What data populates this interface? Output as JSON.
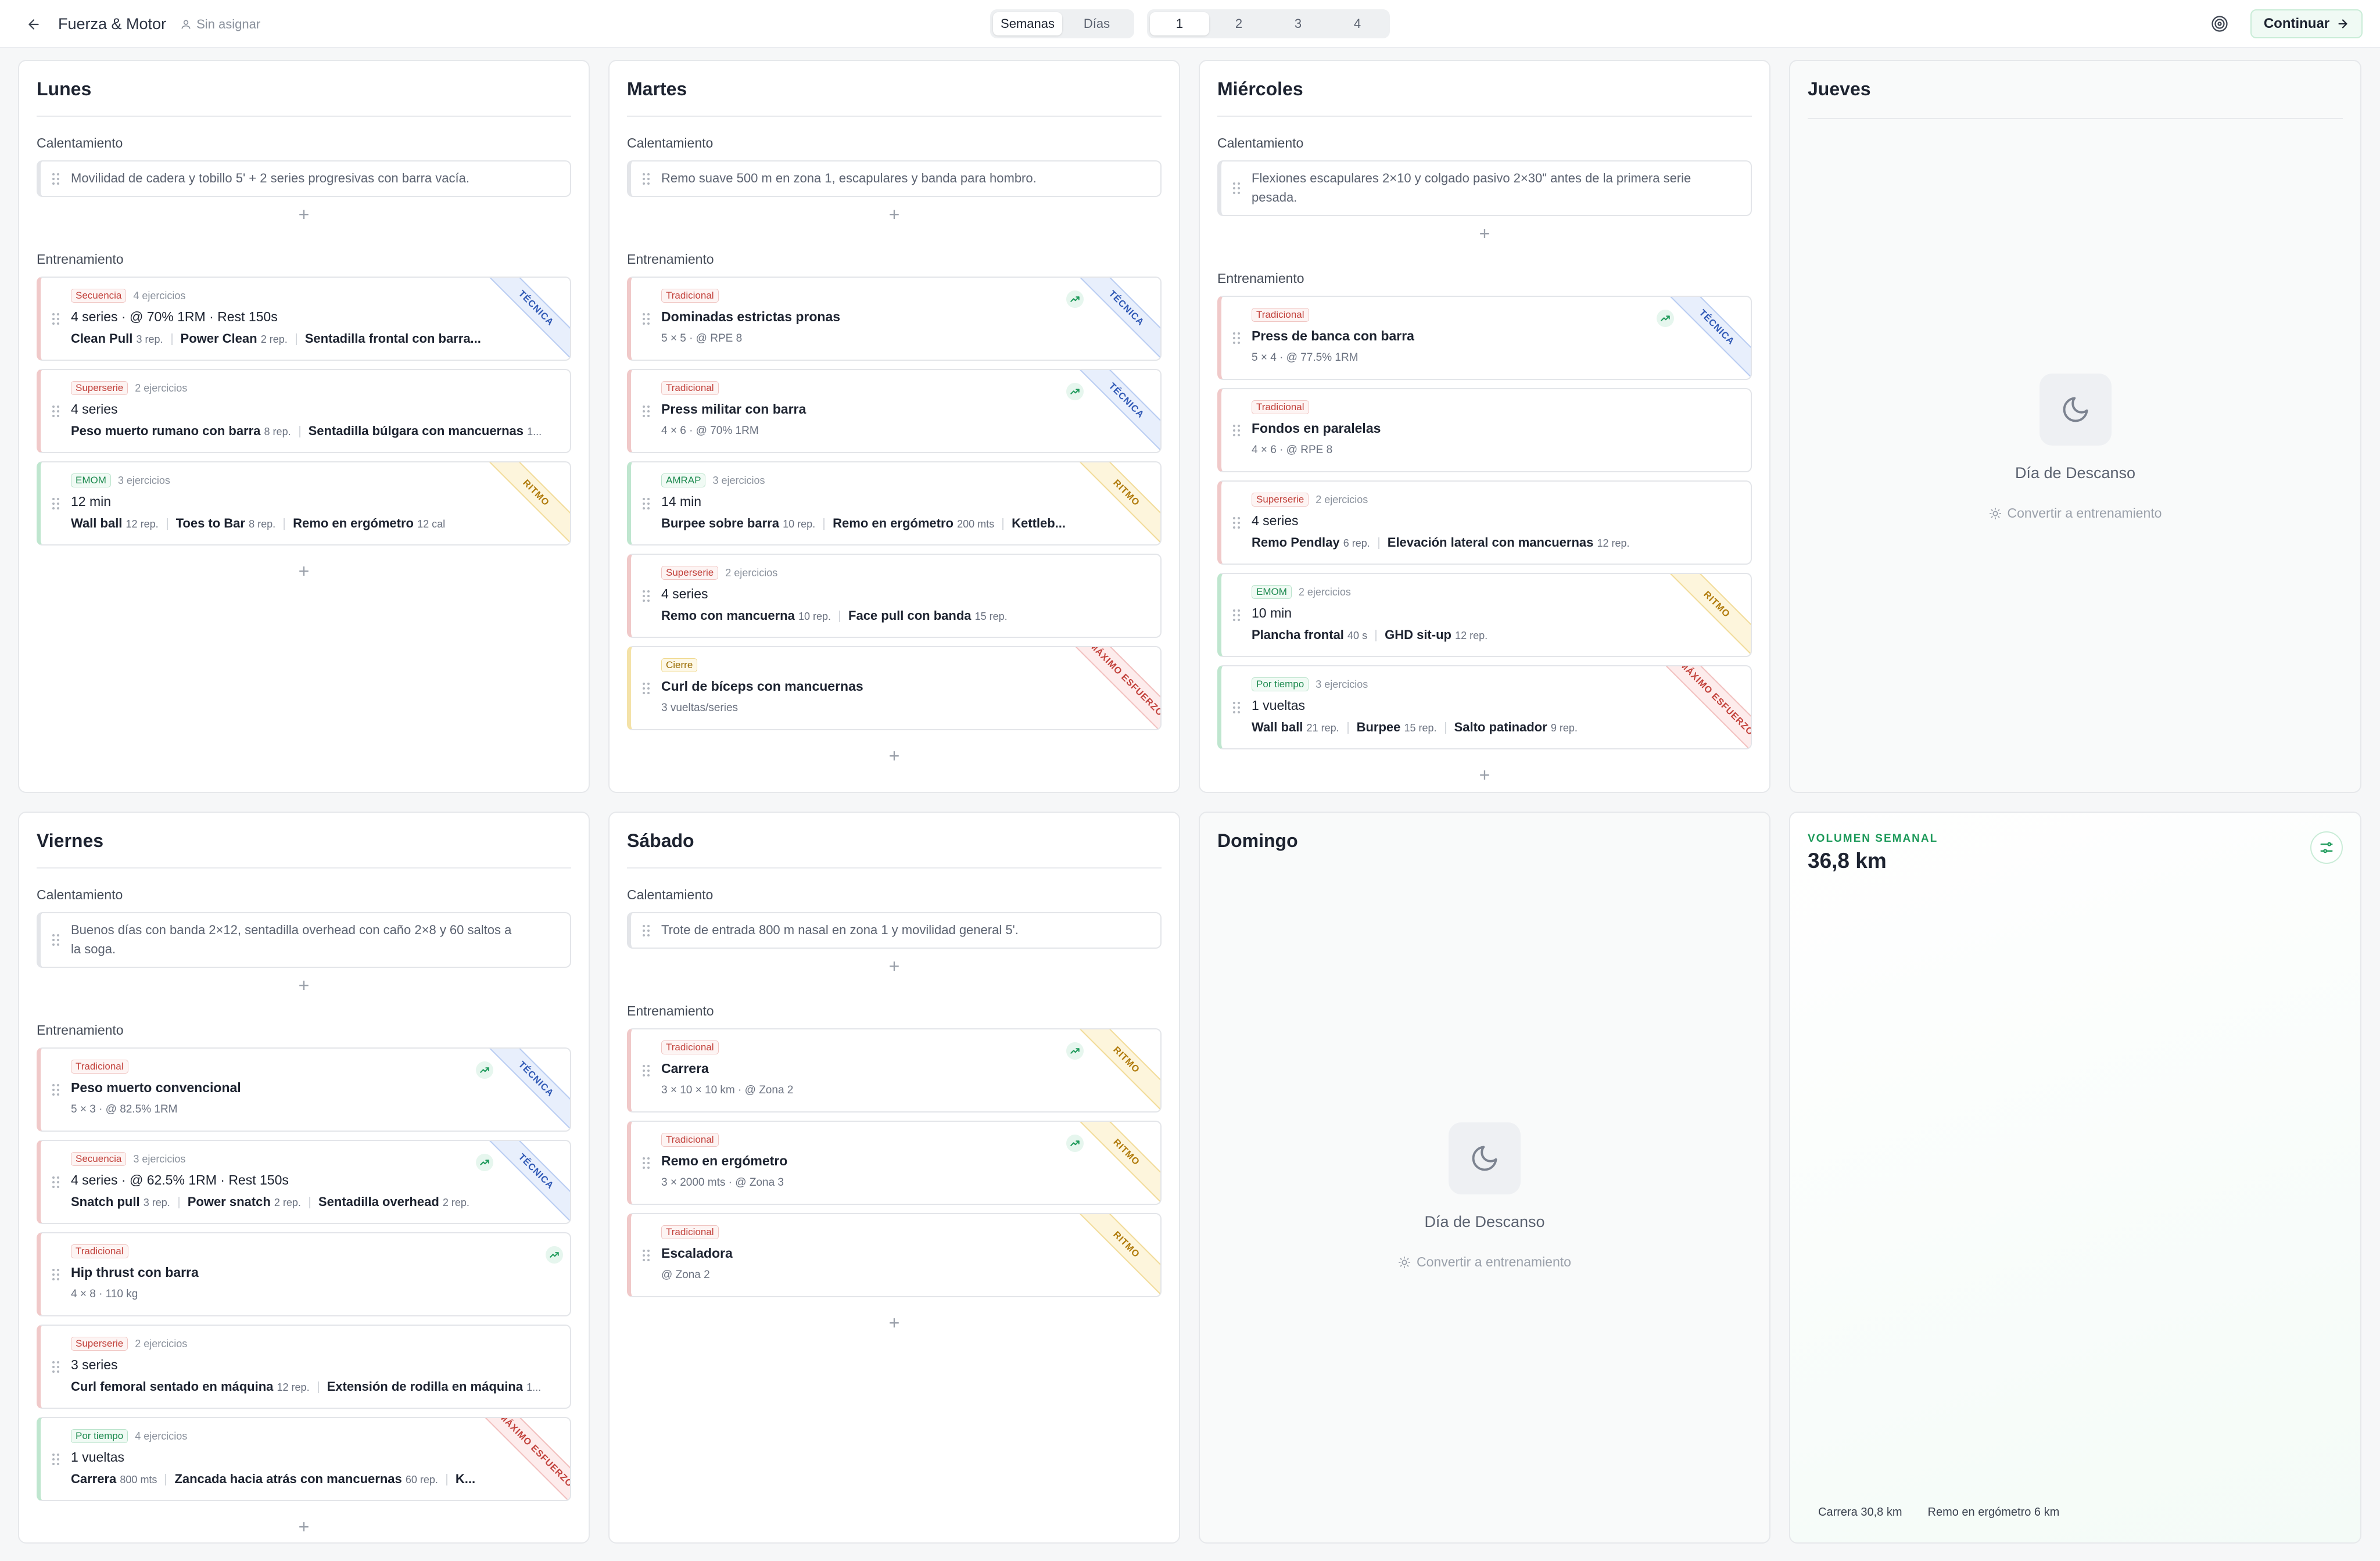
{
  "header": {
    "program_title": "Fuerza & Motor",
    "assignee": "Sin asignar",
    "view_modes": [
      "Semanas",
      "Días"
    ],
    "active_view": "Semanas",
    "weeks": [
      "1",
      "2",
      "3",
      "4"
    ],
    "active_week": "1",
    "continue_label": "Continuar"
  },
  "sections": {
    "warmup": "Calentamiento",
    "training": "Entrenamiento"
  },
  "rest_day": {
    "title": "Día de Descanso",
    "convert": "Convertir a entrenamiento"
  },
  "colors": {
    "accent": "#1d9a5a",
    "traditional": "#c2413b",
    "emom": "#1d8a4f",
    "closing": "#9a6c00",
    "tecnica": "#2f58b5",
    "ritmo": "#b07a0a",
    "maximo": "#c2413b"
  },
  "days": {
    "lunes": {
      "name": "Lunes",
      "warmup": "Movilidad de cadera y tobillo 5' + 2 series progresivas con barra vacía.",
      "blocks": [
        {
          "tag": "Secuencia",
          "count": "4 ejercicios",
          "summary": "4 series · @ 70% 1RM · Rest 150s",
          "exercises": [
            {
              "name": "Clean Pull",
              "reps": "3 rep."
            },
            {
              "name": "Power Clean",
              "reps": "2 rep."
            },
            {
              "name": "Sentadilla frontal con barra...",
              "reps": ""
            }
          ],
          "ribbon": "TÉCNICA"
        },
        {
          "tag": "Superserie",
          "count": "2 ejercicios",
          "summary": "4 series",
          "exercises": [
            {
              "name": "Peso muerto rumano con barra",
              "reps": "8 rep."
            },
            {
              "name": "Sentadilla búlgara con mancuernas",
              "reps": "1..."
            }
          ]
        },
        {
          "tag": "EMOM",
          "count": "3 ejercicios",
          "summary": "12 min",
          "exercises": [
            {
              "name": "Wall ball",
              "reps": "12 rep."
            },
            {
              "name": "Toes to Bar",
              "reps": "8 rep."
            },
            {
              "name": "Remo en ergómetro",
              "reps": "12 cal"
            }
          ],
          "ribbon": "RITMO"
        }
      ]
    },
    "martes": {
      "name": "Martes",
      "warmup": "Remo suave 500 m en zona 1, escapulares y banda para hombro.",
      "blocks": [
        {
          "tag": "Tradicional",
          "title": "Dominadas estrictas pronas",
          "meta": "5 × 5 · @ RPE 8",
          "ribbon": "TÉCNICA"
        },
        {
          "tag": "Tradicional",
          "title": "Press militar con barra",
          "meta": "4 × 6 · @ 70% 1RM",
          "ribbon": "TÉCNICA"
        },
        {
          "tag": "AMRAP",
          "count": "3 ejercicios",
          "summary": "14 min",
          "exercises": [
            {
              "name": "Burpee sobre barra",
              "reps": "10 rep."
            },
            {
              "name": "Remo en ergómetro",
              "reps": "200 mts"
            },
            {
              "name": "Kettleb...",
              "reps": ""
            }
          ],
          "ribbon": "RITMO"
        },
        {
          "tag": "Superserie",
          "count": "2 ejercicios",
          "summary": "4 series",
          "exercises": [
            {
              "name": "Remo con mancuerna",
              "reps": "10 rep."
            },
            {
              "name": "Face pull con banda",
              "reps": "15 rep."
            }
          ]
        },
        {
          "tag": "Cierre",
          "title": "Curl de bíceps con mancuernas",
          "meta": "3 vueltas/series",
          "ribbon": "MÁXIMO ESFUERZO"
        }
      ]
    },
    "miercoles": {
      "name": "Miércoles",
      "warmup": "Flexiones escapulares 2×10 y colgado pasivo 2×30\" antes de la primera serie pesada.",
      "blocks": [
        {
          "tag": "Tradicional",
          "title": "Press de banca con barra",
          "meta": "5 × 4 · @ 77.5% 1RM",
          "ribbon": "TÉCNICA"
        },
        {
          "tag": "Tradicional",
          "title": "Fondos en paralelas",
          "meta": "4 × 6 · @ RPE 8"
        },
        {
          "tag": "Superserie",
          "count": "2 ejercicios",
          "summary": "4 series",
          "exercises": [
            {
              "name": "Remo Pendlay",
              "reps": "6 rep."
            },
            {
              "name": "Elevación lateral con mancuernas",
              "reps": "12 rep."
            }
          ]
        },
        {
          "tag": "EMOM",
          "count": "2 ejercicios",
          "summary": "10 min",
          "exercises": [
            {
              "name": "Plancha frontal",
              "reps": "40 s"
            },
            {
              "name": "GHD sit-up",
              "reps": "12 rep."
            }
          ],
          "ribbon": "RITMO"
        },
        {
          "tag": "Por tiempo",
          "count": "3 ejercicios",
          "summary": "1 vueltas",
          "exercises": [
            {
              "name": "Wall ball",
              "reps": "21 rep."
            },
            {
              "name": "Burpee",
              "reps": "15 rep."
            },
            {
              "name": "Salto patinador",
              "reps": "9 rep."
            }
          ],
          "ribbon": "MÁXIMO ESFUERZO"
        }
      ]
    },
    "jueves": {
      "name": "Jueves"
    },
    "viernes": {
      "name": "Viernes",
      "warmup": "Buenos días con banda 2×12, sentadilla overhead con caño 2×8 y 60 saltos a la soga.",
      "blocks": [
        {
          "tag": "Tradicional",
          "title": "Peso muerto convencional",
          "meta": "5 × 3 · @ 82.5% 1RM",
          "ribbon": "TÉCNICA"
        },
        {
          "tag": "Secuencia",
          "count": "3 ejercicios",
          "summary": "4 series · @ 62.5% 1RM · Rest 150s",
          "exercises": [
            {
              "name": "Snatch pull",
              "reps": "3 rep."
            },
            {
              "name": "Power snatch",
              "reps": "2 rep."
            },
            {
              "name": "Sentadilla overhead",
              "reps": "2 rep."
            }
          ],
          "ribbon": "TÉCNICA"
        },
        {
          "tag": "Tradicional",
          "title": "Hip thrust con barra",
          "meta": "4 × 8 · 110 kg"
        },
        {
          "tag": "Superserie",
          "count": "2 ejercicios",
          "summary": "3 series",
          "exercises": [
            {
              "name": "Curl femoral sentado en máquina",
              "reps": "12 rep."
            },
            {
              "name": "Extensión de rodilla en máquina",
              "reps": "1..."
            }
          ]
        },
        {
          "tag": "Por tiempo",
          "count": "4 ejercicios",
          "summary": "1 vueltas",
          "exercises": [
            {
              "name": "Carrera",
              "reps": "800 mts"
            },
            {
              "name": "Zancada hacia atrás con mancuernas",
              "reps": "60 rep."
            },
            {
              "name": "K...",
              "reps": ""
            }
          ],
          "ribbon": "MÁXIMO ESFUERZO"
        }
      ]
    },
    "sabado": {
      "name": "Sábado",
      "warmup": "Trote de entrada 800 m nasal en zona 1 y movilidad general 5'.",
      "blocks": [
        {
          "tag": "Tradicional",
          "title": "Carrera",
          "meta": "3 × 10 × 10 km · @ Zona 2",
          "ribbon": "RITMO"
        },
        {
          "tag": "Tradicional",
          "title": "Remo en ergómetro",
          "meta": "3 × 2000 mts · @ Zona 3",
          "ribbon": "RITMO"
        },
        {
          "tag": "Tradicional",
          "title": "Escaladora",
          "meta": "@ Zona 2",
          "ribbon": "RITMO"
        }
      ]
    },
    "domingo": {
      "name": "Domingo"
    }
  },
  "volume": {
    "label": "VOLUMEN SEMANAL",
    "value": "36,8 km",
    "legend": [
      "Carrera 30,8 km",
      "Remo en ergómetro 6 km"
    ]
  }
}
